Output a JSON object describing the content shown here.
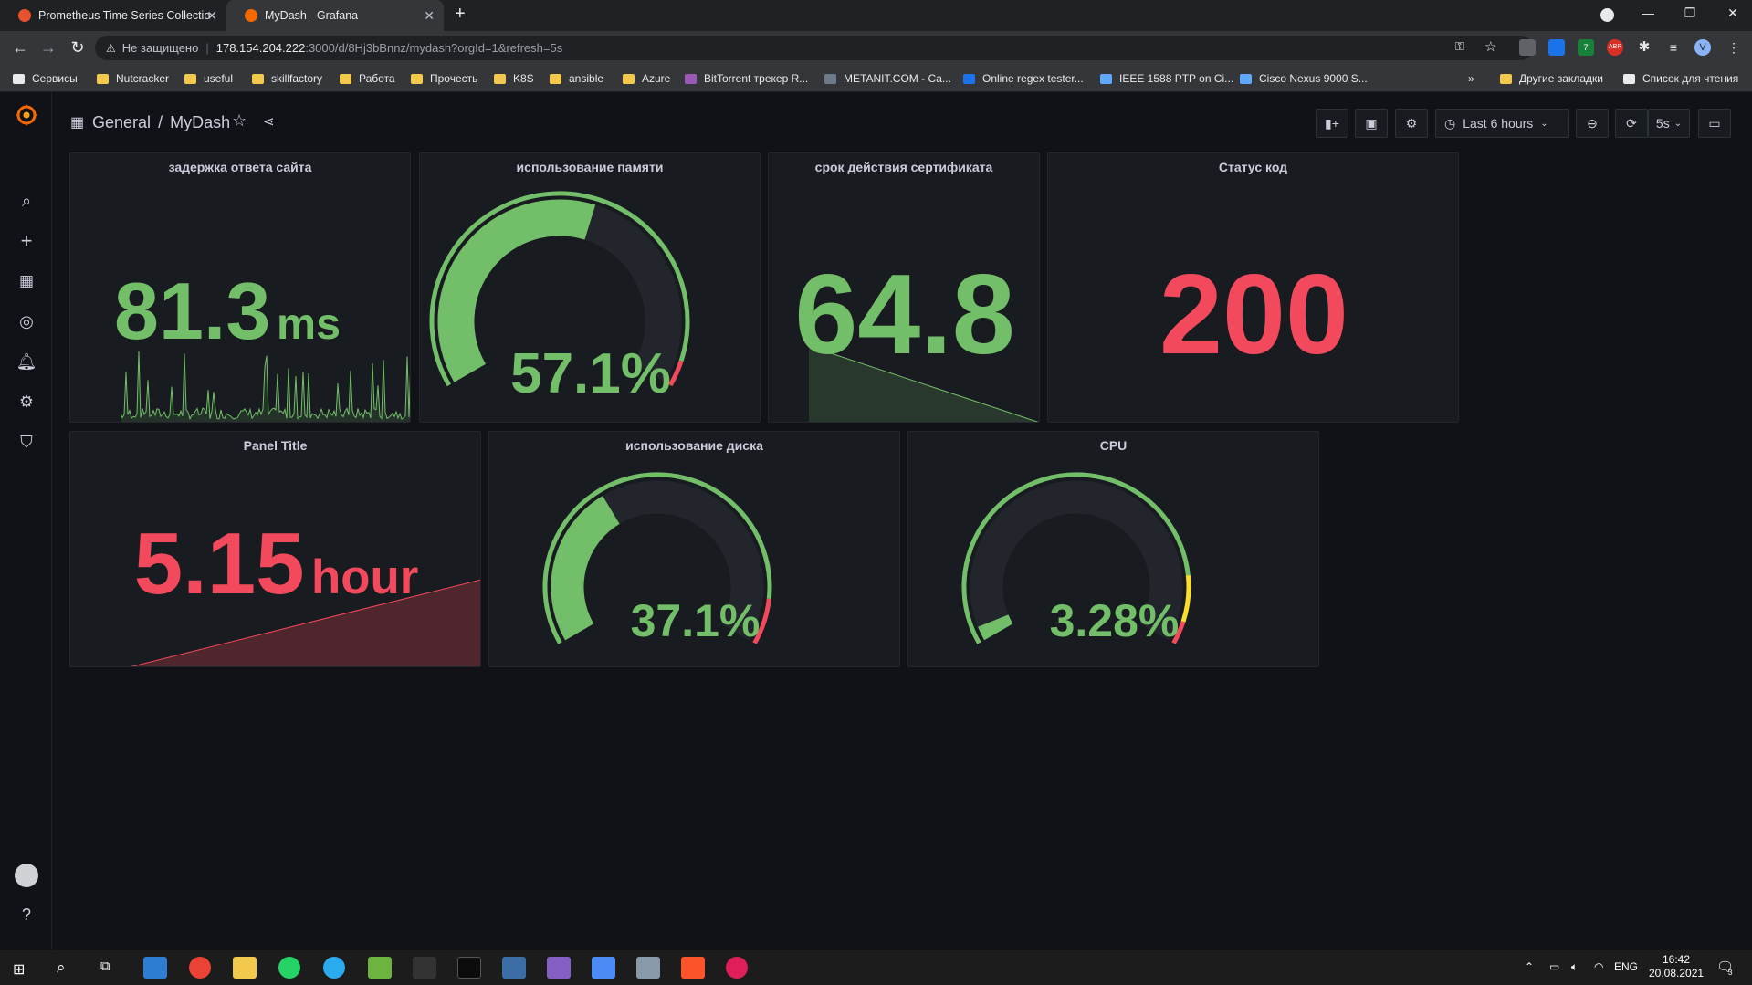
{
  "browser": {
    "tabs": [
      {
        "title": "Prometheus Time Series Collectio",
        "icon": "prometheus-icon",
        "active": false
      },
      {
        "title": "MyDash - Grafana",
        "icon": "grafana-icon",
        "active": true
      }
    ],
    "address": {
      "security_label": "Не защищено",
      "host": "178.154.204.222",
      "path": ":3000/d/8Hj3bBnnz/mydash?orgId=1&refresh=5s"
    },
    "bookmarks": [
      "Сервисы",
      "Nutcracker",
      "useful",
      "skillfactory",
      "Работа",
      "Прочесть",
      "K8S",
      "ansible",
      "Azure",
      "BitTorrent трекер R...",
      "METANIT.COM - Са...",
      "Online regex tester...",
      "IEEE 1588 PTP on Ci...",
      "Cisco Nexus 9000 S..."
    ],
    "bookmarks_overflow": "»",
    "other_bookmarks": "Другие закладки",
    "reading_list": "Список для чтения",
    "profile_initial": "V",
    "ext_badge": "7",
    "abp_label": "ABP"
  },
  "dashboard": {
    "folder": "General",
    "separator": "/",
    "title": "MyDash",
    "time_range": "Last 6 hours",
    "refresh": "5s"
  },
  "panels": {
    "latency": {
      "title": "задержка ответа сайта",
      "value": "81.3",
      "unit": "ms",
      "color": "#73bf69"
    },
    "memory": {
      "title": "использование памяти",
      "value": "57.1%",
      "percent": 57.1,
      "color": "#73bf69"
    },
    "cert": {
      "title": "срок действия сертификата",
      "value": "64.8",
      "color": "#73bf69"
    },
    "status": {
      "title": "Статус код",
      "value": "200",
      "color": "#f2495c"
    },
    "panel_title": {
      "title": "Panel Title",
      "value": "5.15",
      "unit": "hour",
      "color": "#f2495c"
    },
    "disk": {
      "title": "использование диска",
      "value": "37.1%",
      "percent": 37.1,
      "color": "#73bf69"
    },
    "cpu": {
      "title": "CPU",
      "value": "3.28%",
      "percent": 3.28,
      "color": "#73bf69"
    }
  },
  "colors": {
    "green": "#73bf69",
    "red": "#f2495c",
    "orange": "#fade2a",
    "track": "#22252b"
  },
  "taskbar": {
    "lang": "ENG",
    "time": "16:42",
    "date": "20.08.2021",
    "notif_count": "3"
  }
}
